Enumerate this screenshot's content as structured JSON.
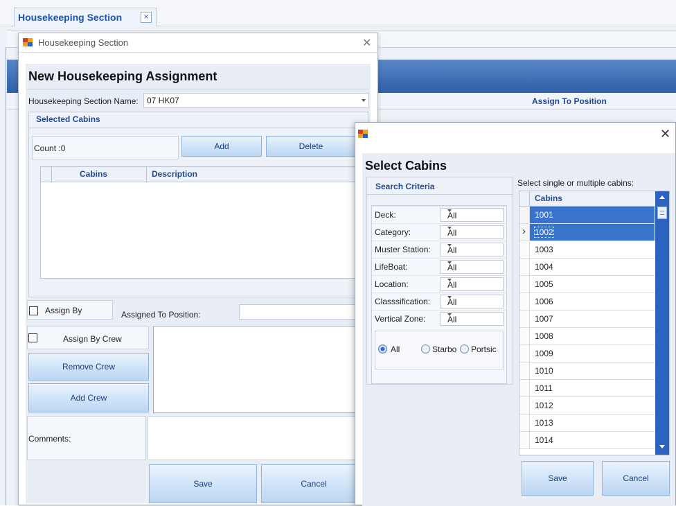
{
  "tab": {
    "label": "Housekeeping Section",
    "close_glyph": "×"
  },
  "bg_grid": {
    "column_header": "Assign To Position"
  },
  "hk_dialog": {
    "title": "Housekeeping Section",
    "heading": "New Housekeeping Assignment",
    "section_name_label": "Housekeeping Section Name:",
    "section_name_value": "07 HK07",
    "selected_cabins_title": "Selected Cabins",
    "count_label": "Count :0",
    "add_label": "Add",
    "delete_label": "Delete",
    "grid_headers": [
      "Cabins",
      "Description"
    ],
    "assign_by_label": "Assign By",
    "assigned_to_position_label": "Assigned To Position:",
    "assign_by_crew_label": "Assign By Crew",
    "remove_crew_label": "Remove Crew",
    "add_crew_label": "Add Crew",
    "comments_label": "Comments:",
    "save_label": "Save",
    "cancel_label": "Cancel"
  },
  "select_dialog": {
    "title": "Select Cabins",
    "search_criteria_title": "Search Criteria",
    "instruction": "Select single or multiple cabins:",
    "criteria": [
      {
        "label": "Deck:",
        "value": "All"
      },
      {
        "label": "Category:",
        "value": "All"
      },
      {
        "label": "Muster Station:",
        "value": "All"
      },
      {
        "label": "LifeBoat:",
        "value": "All"
      },
      {
        "label": "Location:",
        "value": "All"
      },
      {
        "label": "Classsification:",
        "value": "All"
      },
      {
        "label": "Vertical Zone:",
        "value": "All"
      }
    ],
    "side_options": [
      "All",
      "Starbo",
      "Portsic"
    ],
    "cabins_header": "Cabins",
    "cabins": [
      "1001",
      "1002",
      "1003",
      "1004",
      "1005",
      "1006",
      "1007",
      "1008",
      "1009",
      "1010",
      "1011",
      "1012",
      "1013",
      "1014"
    ],
    "row_pointer": "›",
    "save_label": "Save",
    "cancel_label": "Cancel"
  },
  "colors": {
    "accent": "#1a56b8",
    "header_band": "#3f6fb8",
    "selected_row": "#3873cc"
  }
}
